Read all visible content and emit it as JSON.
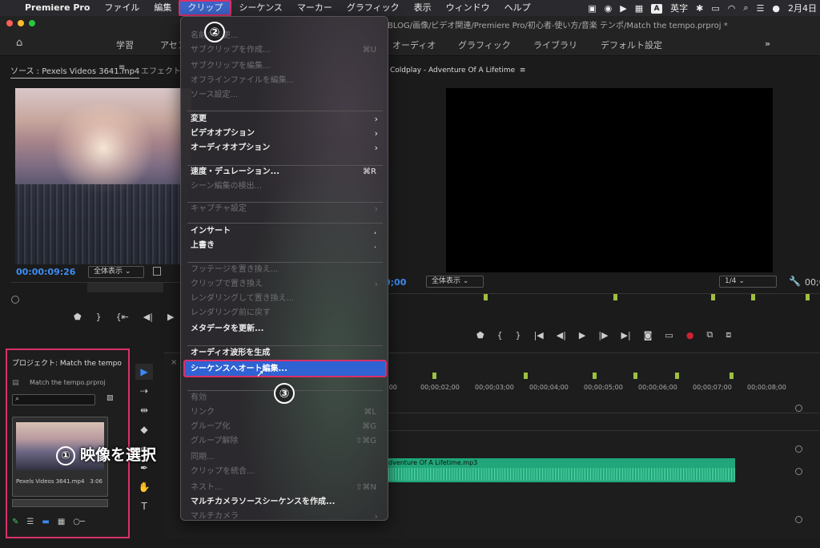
{
  "menubar": {
    "app_name": "Premiere Pro",
    "items": [
      "ファイル",
      "編集",
      "クリップ",
      "シーケンス",
      "マーカー",
      "グラフィック",
      "表示",
      "ウィンドウ",
      "ヘルプ"
    ],
    "input_method": "英字",
    "date": "2月4日"
  },
  "window": {
    "title": "BLOG/画像/ビデオ関連/Premiere Pro/初心者-使い方/音楽 テンポ/Match the tempo.prproj *"
  },
  "workspaces": {
    "items": [
      "学習",
      "アセン",
      "オーディオ",
      "グラフィック",
      "ライブラリ",
      "デフォルト設定"
    ],
    "more": "»"
  },
  "source_panel": {
    "tab_source": "ソース : Pexels Videos 3641.mp4",
    "tab_effect": "エフェクト",
    "timecode": "00:00:09:26",
    "fit": "全体表示"
  },
  "program_panel": {
    "title": "Coldplay - Adventure Of A Lifetime",
    "timecode": "0;00",
    "timecode_right": "00;0",
    "fit": "全体表示",
    "quality": "1/4"
  },
  "project_panel": {
    "title": "プロジェクト: Match the tempo",
    "file": "Match the tempo.prproj",
    "clip_name": "Pexels Videos 3641.mp4",
    "clip_duration": "3:06"
  },
  "timeline": {
    "ruler_labels": [
      ":00",
      "00;00;02;00",
      "00;00;03;00",
      "00;00;04;00",
      "00;00;05;00",
      "00;00;06;00",
      "00;00;07;00",
      "00;00;08;00"
    ],
    "audio_clip": "dventure Of A Lifetime.mp3"
  },
  "clip_menu": {
    "items": [
      {
        "label": "名前を変更...",
        "enabled": false
      },
      {
        "label": "サブクリップを作成...",
        "enabled": false,
        "shortcut": "⌘U"
      },
      {
        "label": "サブクリップを編集...",
        "enabled": false
      },
      {
        "label": "オフラインファイルを編集...",
        "enabled": false
      },
      {
        "label": "ソース設定...",
        "enabled": false
      },
      {
        "label": "変更",
        "enabled": true,
        "submenu": true
      },
      {
        "label": "ビデオオプション",
        "enabled": true,
        "submenu": true
      },
      {
        "label": "オーディオオプション",
        "enabled": true,
        "submenu": true
      },
      {
        "label": "速度・デュレーション...",
        "enabled": true,
        "shortcut": "⌘R"
      },
      {
        "label": "シーン編集の検出...",
        "enabled": false
      },
      {
        "label": "キャプチャ設定",
        "enabled": false,
        "submenu": true
      },
      {
        "label": "インサート",
        "enabled": true,
        "shortcut": ","
      },
      {
        "label": "上書き",
        "enabled": true,
        "shortcut": "."
      },
      {
        "label": "フッテージを置き換え...",
        "enabled": false
      },
      {
        "label": "クリップで置き換え",
        "enabled": false,
        "submenu": true
      },
      {
        "label": "レンダリングして置き換え...",
        "enabled": false
      },
      {
        "label": "レンダリング前に戻す",
        "enabled": false
      },
      {
        "label": "メタデータを更新...",
        "enabled": true
      },
      {
        "label": "オーディオ波形を生成",
        "enabled": true
      },
      {
        "label": "シーケンスへオート編集...",
        "enabled": true,
        "highlighted": true
      },
      {
        "label": "有効",
        "enabled": false
      },
      {
        "label": "リンク",
        "enabled": false,
        "shortcut": "⌘L"
      },
      {
        "label": "グループ化",
        "enabled": false,
        "shortcut": "⌘G"
      },
      {
        "label": "グループ解除",
        "enabled": false,
        "shortcut": "⇧⌘G"
      },
      {
        "label": "同期...",
        "enabled": false
      },
      {
        "label": "クリップを統合...",
        "enabled": false
      },
      {
        "label": "ネスト...",
        "enabled": false,
        "shortcut": "⇧⌘N"
      },
      {
        "label": "マルチカメラソースシーケンスを作成...",
        "enabled": true
      },
      {
        "label": "マルチカメラ",
        "enabled": false,
        "submenu": true
      }
    ]
  },
  "annotations": {
    "step1_number": "①",
    "step1": "映像を選択",
    "step2": "②",
    "step3": "③"
  },
  "colors": {
    "highlight_border": "#d9306a",
    "menu_selection": "#2f62d2",
    "timecode_blue": "#3f8df5",
    "audio_clip": "#20a67a"
  }
}
